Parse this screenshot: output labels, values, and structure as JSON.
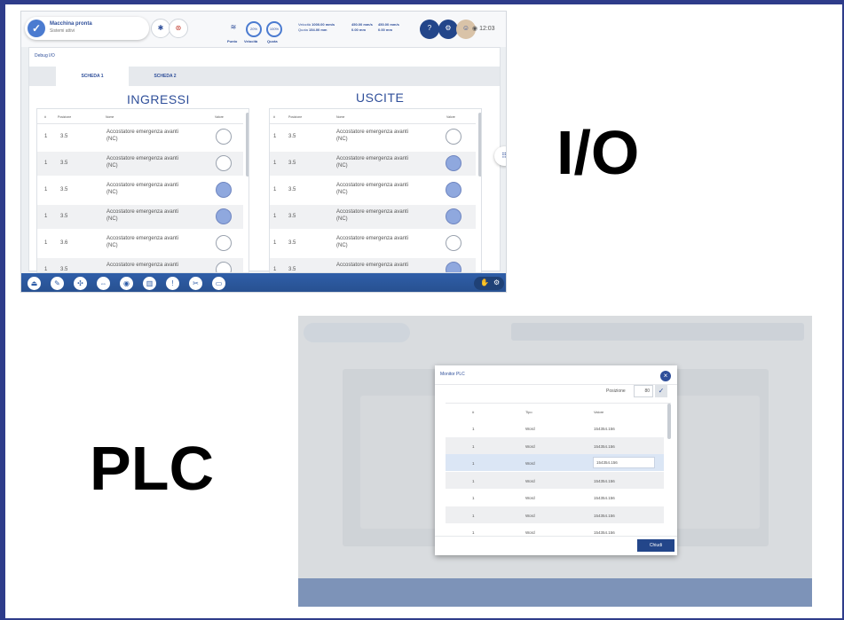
{
  "labels": {
    "io": "I/O",
    "plc": "PLC"
  },
  "io_screen": {
    "status_title": "Macchina pronta",
    "status_sub": "Sistemi attivi",
    "gauges": [
      {
        "value": "20%",
        "label": "Punto"
      },
      {
        "value": "100%",
        "label": "Velocità"
      },
      {
        "value": "",
        "label": "Quota"
      }
    ],
    "readouts": {
      "col1_label": "Velocità",
      "col1_value": "1000.00 mm/s",
      "col1b_label": "Quota",
      "col1b_value": "154.00 mm",
      "col2_value": "450.00 mm/s",
      "col2b_value": "0.00 mm",
      "col3_value": "450.00 mm/s",
      "col3b_value": "0.00 mm"
    },
    "clock": "12:03",
    "panel_title": "Debug I/O",
    "tabs": [
      "SCHEDA 1",
      "SCHEDA 2"
    ],
    "inputs_title": "INGRESSI",
    "outputs_title": "USCITE",
    "columns": {
      "num": "#",
      "pos": "Posizione",
      "name": "Nome",
      "value": "Valore"
    },
    "inputs": [
      {
        "n": "1",
        "pos": "3.5",
        "name1": "Accostatore emergenza avanti",
        "name2": "(NC)",
        "on": false
      },
      {
        "n": "1",
        "pos": "3.5",
        "name1": "Accostatore emergenza avanti",
        "name2": "(NC)",
        "on": false
      },
      {
        "n": "1",
        "pos": "3.5",
        "name1": "Accostatore emergenza avanti",
        "name2": "(NC)",
        "on": true
      },
      {
        "n": "1",
        "pos": "3.5",
        "name1": "Accostatore emergenza avanti",
        "name2": "(NC)",
        "on": true
      },
      {
        "n": "1",
        "pos": "3.6",
        "name1": "Accostatore emergenza avanti",
        "name2": "(NC)",
        "on": false
      },
      {
        "n": "1",
        "pos": "3.5",
        "name1": "Accostatore emergenza avanti",
        "name2": "",
        "on": false
      }
    ],
    "outputs": [
      {
        "n": "1",
        "pos": "3.5",
        "name1": "Accostatore emergenza avanti",
        "name2": "(NC)",
        "on": false
      },
      {
        "n": "1",
        "pos": "3.5",
        "name1": "Accostatore emergenza avanti",
        "name2": "(NC)",
        "on": true
      },
      {
        "n": "1",
        "pos": "3.5",
        "name1": "Accostatore emergenza avanti",
        "name2": "(NC)",
        "on": true
      },
      {
        "n": "1",
        "pos": "3.5",
        "name1": "Accostatore emergenza avanti",
        "name2": "(NC)",
        "on": true
      },
      {
        "n": "1",
        "pos": "3.5",
        "name1": "Accostatore emergenza avanti",
        "name2": "(NC)",
        "on": false
      },
      {
        "n": "1",
        "pos": "3.5",
        "name1": "Accostatore emergenza avanti",
        "name2": "",
        "on": true
      }
    ],
    "bottom_icons": [
      "eject-icon",
      "edit-icon",
      "network-icon",
      "link-icon",
      "steering-icon",
      "chart-icon",
      "alert-icon",
      "wrench-icon",
      "window-icon"
    ],
    "colors": {
      "accent": "#2f4f9a",
      "bar": "#2f5ea8",
      "led_on": "#8fa8de"
    }
  },
  "plc_screen": {
    "modal_title": "Monitor PLC",
    "position_label": "Posizione",
    "position_value": "80",
    "columns": {
      "num": "#",
      "type": "Tipo",
      "value": "Valore"
    },
    "rows": [
      {
        "n": "1",
        "type": "Word",
        "value": "154354.156"
      },
      {
        "n": "1",
        "type": "Word",
        "value": "154354.156"
      },
      {
        "n": "1",
        "type": "Word",
        "value": "154354.156",
        "selected": true
      },
      {
        "n": "1",
        "type": "Word",
        "value": "154354.156"
      },
      {
        "n": "1",
        "type": "Word",
        "value": "154354.156"
      },
      {
        "n": "1",
        "type": "Word",
        "value": "154354.156"
      },
      {
        "n": "1",
        "type": "Word",
        "value": "154354.156"
      }
    ],
    "close_label": "Chiudi"
  }
}
